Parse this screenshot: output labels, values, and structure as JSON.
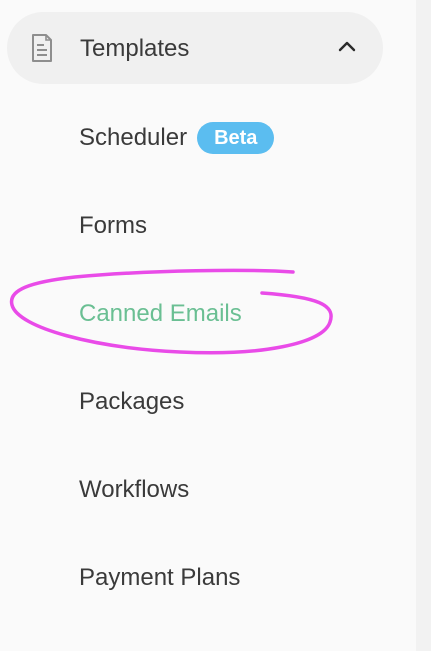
{
  "section": {
    "icon": "document-icon",
    "title": "Templates",
    "toggle_icon": "chevron-up-icon"
  },
  "nav": {
    "items": [
      {
        "label": "Scheduler",
        "badge": "Beta"
      },
      {
        "label": "Forms"
      },
      {
        "label": "Canned Emails",
        "active": true
      },
      {
        "label": "Packages"
      },
      {
        "label": "Workflows"
      },
      {
        "label": "Payment Plans"
      }
    ]
  },
  "colors": {
    "active_text": "#6abf93",
    "badge_bg": "#5bbdf0",
    "annotation_stroke": "#e94be8",
    "text": "#3a3a3a"
  }
}
